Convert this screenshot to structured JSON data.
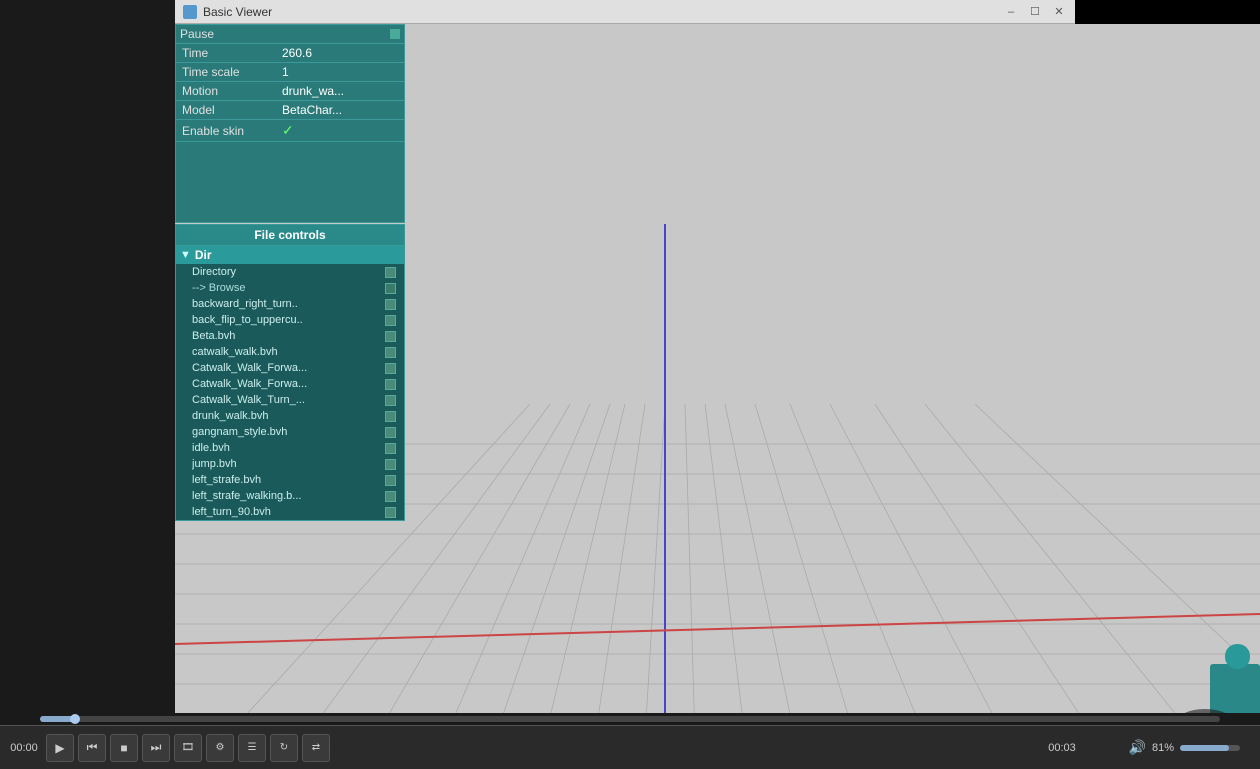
{
  "titlebar": {
    "icon_label": "viewer-icon",
    "title": "Basic Viewer",
    "minimize_label": "–",
    "restore_label": "☐",
    "close_label": "✕"
  },
  "props": {
    "pause_label": "Pause",
    "time_label": "Time",
    "time_value": "260.6",
    "timescale_label": "Time scale",
    "timescale_value": "1",
    "motion_label": "Motion",
    "motion_value": "drunk_wa...",
    "model_label": "Model",
    "model_value": "BetaChar...",
    "skin_label": "Enable skin",
    "skin_value": "✓"
  },
  "file_controls": {
    "header": "File controls",
    "dir_name": "Dir",
    "directory_label": "Directory",
    "browse_label": "--> Browse",
    "files": [
      "backward_right_turn..",
      "back_flip_to_uppercu..",
      "Beta.bvh",
      "catwalk_walk.bvh",
      "Catwalk_Walk_Forwa...",
      "Catwalk_Walk_Forwa...",
      "Catwalk_Walk_Turn_...",
      "drunk_walk.bvh",
      "gangnam_style.bvh",
      "idle.bvh",
      "jump.bvh",
      "left_strafe.bvh",
      "left_strafe_walking.b...",
      "left_turn_90.bvh"
    ]
  },
  "transport": {
    "time_start": "00:00",
    "time_end": "00:03",
    "play_label": "▶",
    "rewind_label": "⏮",
    "stop_label": "■",
    "next_label": "⏭",
    "frame_prev_label": "◁",
    "frame_next_label": "▷",
    "shuffle_label": "⇄",
    "volume_pct": "81%",
    "progress_pct": 3
  }
}
